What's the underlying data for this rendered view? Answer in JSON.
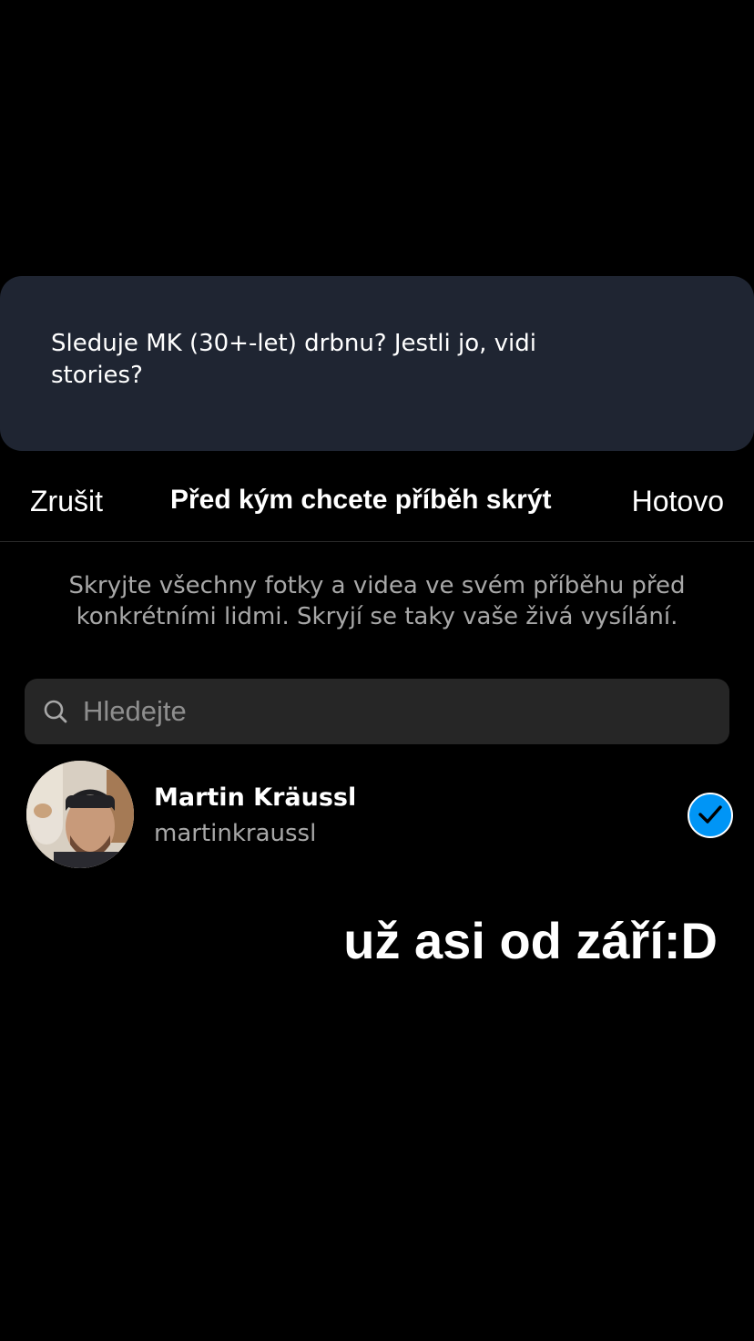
{
  "question": {
    "text_line1": "Sleduje MK (30+-let) drbnu? Jestli jo, vidi",
    "text_line2": "stories?"
  },
  "header": {
    "cancel_label": "Zrušit",
    "title": "Před kým chcete příběh skrýt",
    "done_label": "Hotovo"
  },
  "description": {
    "line1": "Skryjte všechny fotky a videa ve svém příběhu před",
    "line2": "konkrétními lidmi. Skryjí se taky vaše živá vysílání."
  },
  "search": {
    "placeholder": "Hledejte",
    "value": ""
  },
  "users": [
    {
      "name": "Martin Kräussl",
      "username": "martinkraussl",
      "selected": true
    }
  ],
  "overlay": {
    "text": "už asi od září:D"
  },
  "colors": {
    "background": "#000000",
    "card": "#1f2532",
    "accent": "#0095f6",
    "secondary_text": "#a8a8a8",
    "search_bg": "#262626"
  },
  "icons": [
    "search-icon",
    "checkmark-icon",
    "avatar"
  ]
}
